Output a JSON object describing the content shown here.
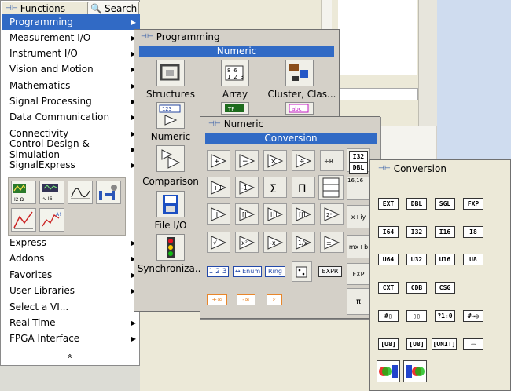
{
  "functions_palette": {
    "tab_functions": "Functions",
    "tab_search": "Search",
    "menu": [
      {
        "label": "Programming",
        "selected": true,
        "submenu": true
      },
      {
        "label": "Measurement I/O",
        "submenu": true
      },
      {
        "label": "Instrument I/O",
        "submenu": true
      },
      {
        "label": "Vision and Motion",
        "submenu": true
      },
      {
        "label": "Mathematics",
        "submenu": true
      },
      {
        "label": "Signal Processing",
        "submenu": true
      },
      {
        "label": "Data Communication",
        "submenu": true
      },
      {
        "label": "Connectivity",
        "submenu": true
      },
      {
        "label": "Control Design & Simulation",
        "submenu": true
      },
      {
        "label": "SignalExpress",
        "submenu": true
      }
    ],
    "menu2": [
      {
        "label": "Express",
        "submenu": true
      },
      {
        "label": "Addons",
        "submenu": true
      },
      {
        "label": "Favorites",
        "submenu": true
      },
      {
        "label": "User Libraries",
        "submenu": true
      },
      {
        "label": "Select a VI...",
        "submenu": false
      },
      {
        "label": "Real-Time",
        "submenu": true
      },
      {
        "label": "FPGA Interface",
        "submenu": true
      }
    ],
    "icon_strip_labels": [
      "I2 Ω",
      "∿∿ I6"
    ],
    "expand_glyph": "»"
  },
  "programming_palette": {
    "title": "Programming",
    "header": "Numeric",
    "items": [
      "Structures",
      "Array",
      "Cluster, Clas...",
      "Numeric",
      "Comparison",
      "File I/O",
      "Synchroniza..."
    ]
  },
  "numeric_palette": {
    "title": "Numeric",
    "header": "Conversion",
    "constants": [
      "1 2 3",
      "↔ Enum",
      "Ring",
      "EXPR"
    ],
    "inf": [
      "+∞",
      "-∞",
      "ε"
    ]
  },
  "conversion_palette": {
    "title": "Conversion",
    "rows": [
      [
        "EXT",
        "DBL",
        "SGL",
        "FXP"
      ],
      [
        "I64",
        "I32",
        "I16",
        "I8"
      ],
      [
        "U64",
        "U32",
        "U16",
        "U8"
      ],
      [
        "CXT",
        "CDB",
        "CSG"
      ],
      [
        "#▯",
        "▯▯",
        "?1:0",
        "#→◎"
      ],
      [
        "[U8]",
        "[U8]",
        "[UNIT]",
        "▭"
      ]
    ],
    "extra_icons": [
      "I32",
      "DBL",
      "16,16",
      "x+iy",
      "mx+b",
      "FXP",
      "π"
    ]
  }
}
